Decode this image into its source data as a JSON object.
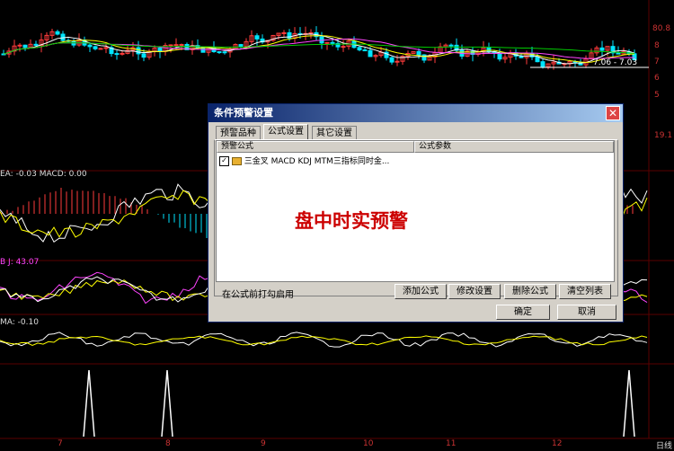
{
  "indicators": {
    "macd_label": "EA: -0.03  MACD: 0.00",
    "kdj_label": "B  J: 43.07",
    "ma_label": "MA: -0.10"
  },
  "price_labels": {
    "top_right": "80.8",
    "mid_right": "7.06 - 7.03",
    "side_b": "8",
    "side_c": "7",
    "side_d": "6",
    "side_e": "5",
    "side_f": "19.1"
  },
  "axes": {
    "x_ticks": [
      "7",
      "8",
      "9",
      "10",
      "11",
      "12"
    ],
    "corner": "日线"
  },
  "overlay_text": "盘中时实预警",
  "dialog": {
    "title": "条件预警设置",
    "close": "✕",
    "tabs": [
      "预警品种",
      "公式设置",
      "其它设置"
    ],
    "columns": [
      "预警公式",
      "公式参数"
    ],
    "rows": [
      {
        "checked": "✓",
        "text": "三金叉 MACD KDJ MTM三指标同时金..."
      }
    ],
    "note": "在公式前打勾启用",
    "buttons": {
      "add": "添加公式",
      "edit": "修改设置",
      "delete": "删除公式",
      "clear": "清空列表",
      "ok": "确定",
      "cancel": "取消"
    }
  }
}
